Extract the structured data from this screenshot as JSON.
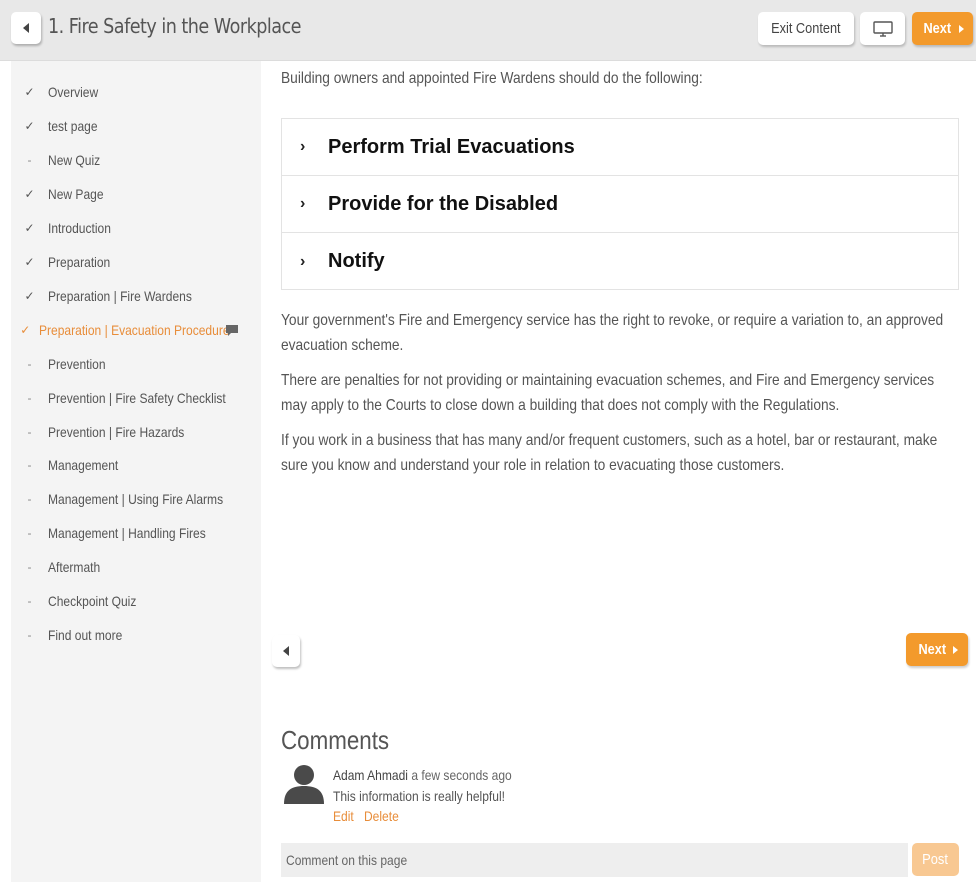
{
  "header": {
    "title": "1. Fire Safety in the Workplace",
    "exit_label": "Exit Content",
    "next_label": "Next"
  },
  "sidebar": {
    "items": [
      {
        "label": "Overview",
        "status": "complete"
      },
      {
        "label": "test page",
        "status": "complete"
      },
      {
        "label": "New Quiz",
        "status": "incomplete"
      },
      {
        "label": "New Page",
        "status": "complete"
      },
      {
        "label": "Introduction",
        "status": "complete"
      },
      {
        "label": "Preparation",
        "status": "complete"
      },
      {
        "label": "Preparation | Fire Wardens",
        "status": "complete"
      },
      {
        "label": "Preparation | Evacuation Procedure",
        "status": "active"
      },
      {
        "label": "Prevention",
        "status": "incomplete"
      },
      {
        "label": "Prevention | Fire Safety Checklist",
        "status": "incomplete"
      },
      {
        "label": "Prevention | Fire Hazards",
        "status": "incomplete"
      },
      {
        "label": "Management",
        "status": "incomplete"
      },
      {
        "label": "Management | Using Fire Alarms",
        "status": "incomplete"
      },
      {
        "label": "Management | Handling Fires",
        "status": "incomplete"
      },
      {
        "label": "Aftermath",
        "status": "incomplete"
      },
      {
        "label": "Checkpoint Quiz",
        "status": "incomplete"
      },
      {
        "label": "Find out more",
        "status": "incomplete"
      }
    ]
  },
  "main": {
    "intro": "Building owners and appointed Fire Wardens should do the following:",
    "accordion": [
      {
        "label": "Perform Trial Evacuations"
      },
      {
        "label": "Provide for the Disabled"
      },
      {
        "label": "Notify"
      }
    ],
    "paragraphs": [
      "Your government's Fire and Emergency service has the right to revoke, or require a variation to, an approved evacuation scheme.",
      "There are penalties for not providing or maintaining evacuation schemes, and Fire and Emergency services may apply to the Courts to close down a building that does not comply with the Regulations.",
      "If you work in a business that has many and/or frequent customers, such as a hotel, bar or restaurant, make sure you know and understand your role in relation to evacuating those customers."
    ],
    "next_label": "Next"
  },
  "comments": {
    "title": "Comments",
    "items": [
      {
        "author": "Adam Ahmadi",
        "time": "a few seconds ago",
        "text": "This information is really helpful!",
        "edit_label": "Edit",
        "delete_label": "Delete"
      }
    ],
    "input_placeholder": "Comment on this page",
    "post_label": "Post"
  },
  "colors": {
    "accent": "#f39a2c",
    "active_link": "#e88d3a",
    "sidebar_bg": "#f4f4f4",
    "header_bg": "#e8e8e8"
  },
  "icons": {
    "back": "caret-left-icon",
    "next": "caret-right-icon",
    "screen": "monitor-icon",
    "check": "checkmark-icon",
    "chevron": "chevron-right-icon",
    "comment": "speech-bubble-icon",
    "avatar": "user-silhouette-icon"
  }
}
